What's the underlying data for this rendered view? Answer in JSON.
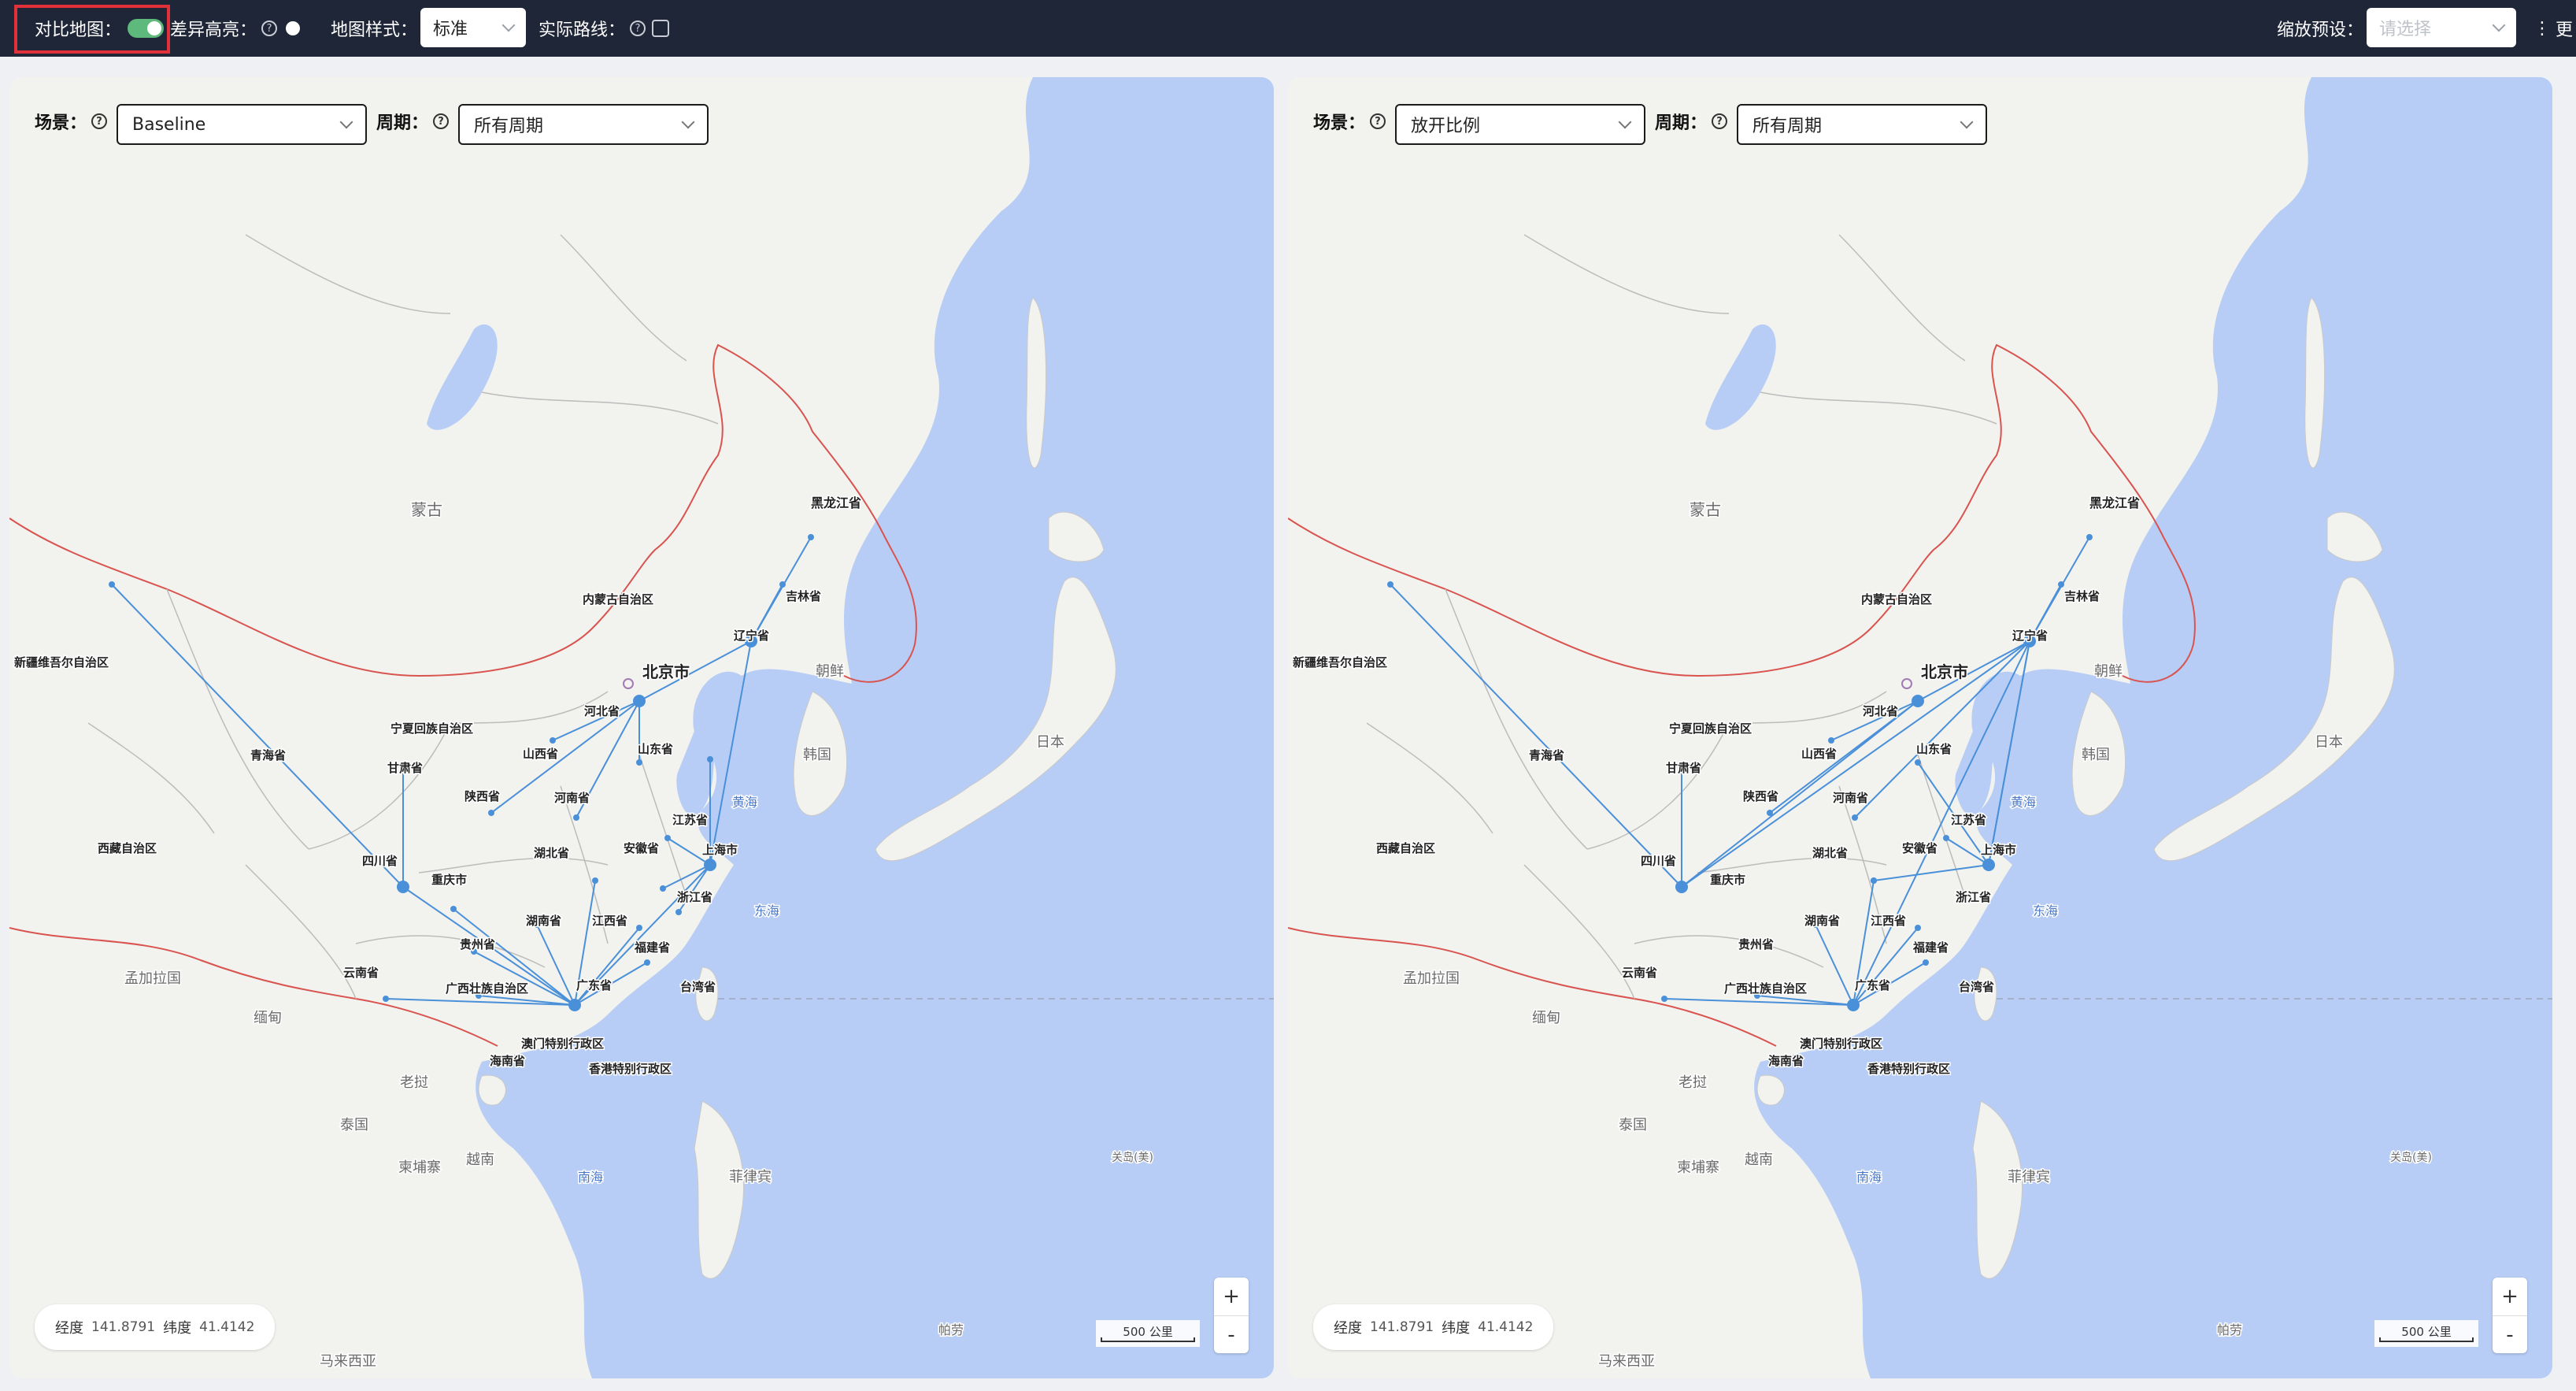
{
  "toolbar": {
    "compare_map_label": "对比地图：",
    "compare_map_on": true,
    "diff_highlight_label": "差异高亮：",
    "diff_highlight_on": false,
    "map_style_label": "地图样式：",
    "map_style_value": "标准",
    "actual_route_label": "实际路线：",
    "actual_route_checked": false,
    "zoom_preset_label": "缩放预设：",
    "zoom_preset_placeholder": "请选择",
    "more_label": "更"
  },
  "panels": [
    {
      "scenario_label": "场景：",
      "scenario_value": "Baseline",
      "period_label": "周期：",
      "period_value": "所有周期",
      "coords": {
        "lng_label": "经度",
        "lng": "141.8791",
        "lat_label": "纬度",
        "lat": "41.4142"
      },
      "zoom_in": "+",
      "zoom_out": "-",
      "scale_text": "500 公里"
    },
    {
      "scenario_label": "场景：",
      "scenario_value": "放开比例",
      "period_label": "周期：",
      "period_value": "所有周期",
      "coords": {
        "lng_label": "经度",
        "lng": "141.8791",
        "lat_label": "纬度",
        "lat": "41.4142"
      },
      "zoom_in": "+",
      "zoom_out": "-",
      "scale_text": "500 公里"
    }
  ],
  "map_labels": {
    "mongolia": "蒙古",
    "heilongjiang": "黑龙江省",
    "jilin": "吉林省",
    "liaoning": "辽宁省",
    "inner_mongolia": "内蒙古自治区",
    "xinjiang": "新疆维吾尔自治区",
    "beijing": "北京市",
    "hebei": "河北省",
    "shanxi": "山西省",
    "shandong": "山东省",
    "ningxia": "宁夏回族自治区",
    "gansu": "甘肃省",
    "qinghai": "青海省",
    "shaanxi": "陕西省",
    "henan": "河南省",
    "jiangsu": "江苏省",
    "shanghai": "上海市",
    "anhui": "安徽省",
    "hubei": "湖北省",
    "tibet": "西藏自治区",
    "sichuan": "四川省",
    "chongqing": "重庆市",
    "zhejiang": "浙江省",
    "hunan": "湖南省",
    "jiangxi": "江西省",
    "guizhou": "贵州省",
    "fujian": "福建省",
    "yunnan": "云南省",
    "guangxi": "广西壮族自治区",
    "guangdong": "广东省",
    "taiwan": "台湾省",
    "macau": "澳门特别行政区",
    "hongkong": "香港特别行政区",
    "hainan": "海南省",
    "bangladesh": "孟加拉国",
    "myanmar": "缅甸",
    "laos": "老挝",
    "thailand": "泰国",
    "cambodia": "柬埔寨",
    "vietnam": "越南",
    "malaysia": "马来西亚",
    "philippines": "菲律宾",
    "palau": "帕劳",
    "guam": "关岛(美)",
    "japan": "日本",
    "korea": "韩国",
    "north_korea": "朝鲜",
    "yellow_sea": "黄海",
    "east_sea": "东海",
    "south_sea": "南海"
  },
  "colors": {
    "route": "#4a90d9",
    "sea": "#b7cdf5",
    "land": "#f2f2ef",
    "border": "#d9534f",
    "toolbar_bg": "#1e2638",
    "highlight": "#e0313a"
  }
}
